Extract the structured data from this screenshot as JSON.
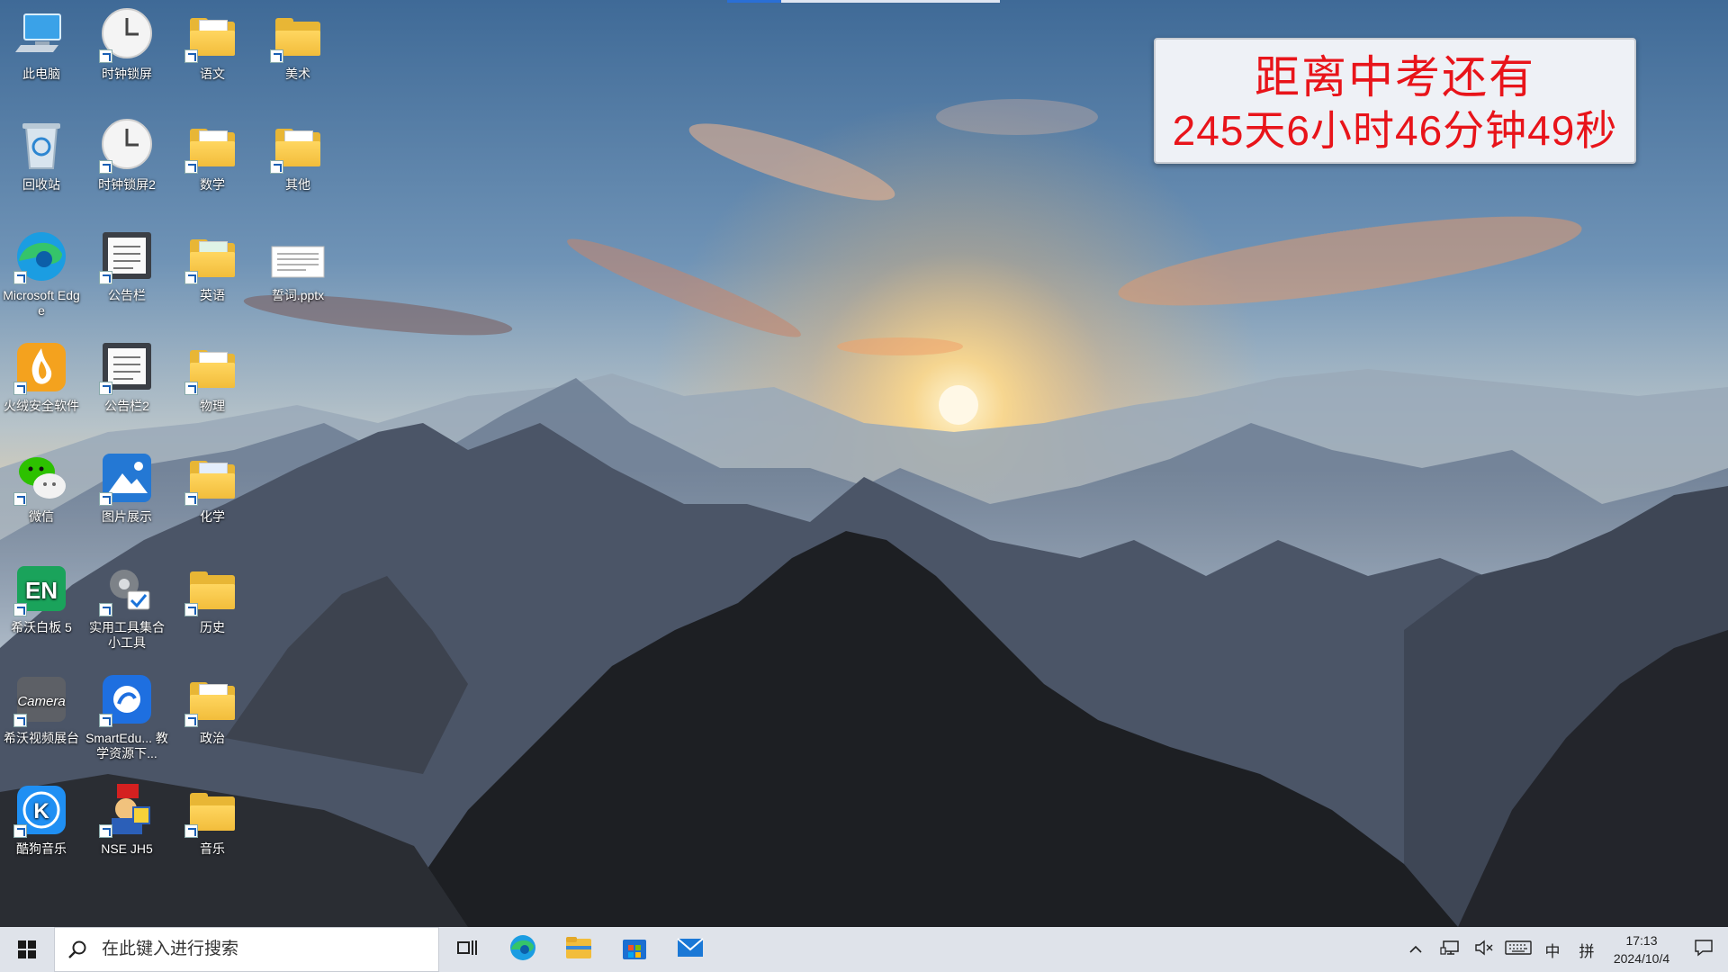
{
  "desktop": {
    "icons": [
      {
        "label": "此电脑",
        "icon": "this-pc-icon"
      },
      {
        "label": "时钟锁屏",
        "icon": "clock-icon"
      },
      {
        "label": "语文",
        "icon": "folder-icon"
      },
      {
        "label": "美术",
        "icon": "folder-icon"
      },
      {
        "label": "回收站",
        "icon": "recycle-bin-icon"
      },
      {
        "label": "时钟锁屏2",
        "icon": "clock-icon"
      },
      {
        "label": "数学",
        "icon": "folder-icon"
      },
      {
        "label": "其他",
        "icon": "folder-icon"
      },
      {
        "label": "Microsoft Edge",
        "icon": "edge-icon"
      },
      {
        "label": "公告栏",
        "icon": "notice-board-icon"
      },
      {
        "label": "英语",
        "icon": "folder-icon"
      },
      {
        "label": "誓词.pptx",
        "icon": "pptx-file-icon"
      },
      {
        "label": "火绒安全软件",
        "icon": "huorong-icon"
      },
      {
        "label": "公告栏2",
        "icon": "notice-board-icon"
      },
      {
        "label": "物理",
        "icon": "folder-icon"
      },
      {
        "label": "微信",
        "icon": "wechat-icon"
      },
      {
        "label": "图片展示",
        "icon": "picture-viewer-icon"
      },
      {
        "label": "化学",
        "icon": "folder-icon"
      },
      {
        "label": "希沃白板 5",
        "icon": "easinote-icon"
      },
      {
        "label": "实用工具集合小工具",
        "icon": "tools-gear-icon"
      },
      {
        "label": "历史",
        "icon": "folder-icon"
      },
      {
        "label": "希沃视频展台",
        "icon": "camera-app-icon"
      },
      {
        "label": "SmartEdu... 教学资源下...",
        "icon": "smartedu-icon"
      },
      {
        "label": "政治",
        "icon": "folder-icon"
      },
      {
        "label": "酷狗音乐",
        "icon": "kugou-icon"
      },
      {
        "label": "NSE JH5",
        "icon": "nse-icon"
      },
      {
        "label": "音乐",
        "icon": "folder-icon"
      }
    ]
  },
  "countdown": {
    "line1": "距离中考还有",
    "line2": "245天6小时46分钟49秒",
    "text_color": "#e8141a"
  },
  "taskbar": {
    "search_placeholder": "在此键入进行搜索",
    "apps": [
      "task-view-icon",
      "edge-icon",
      "file-explorer-icon",
      "microsoft-store-icon",
      "mail-icon"
    ],
    "tray": {
      "ime_lang": "中",
      "ime_mode": "拼",
      "time": "17:13",
      "date": "2024/10/4"
    }
  },
  "colors": {
    "taskbar_bg": "#dfe3ea",
    "folder_yellow": "#f2bd3b",
    "accent_blue": "#2a6fd6"
  }
}
